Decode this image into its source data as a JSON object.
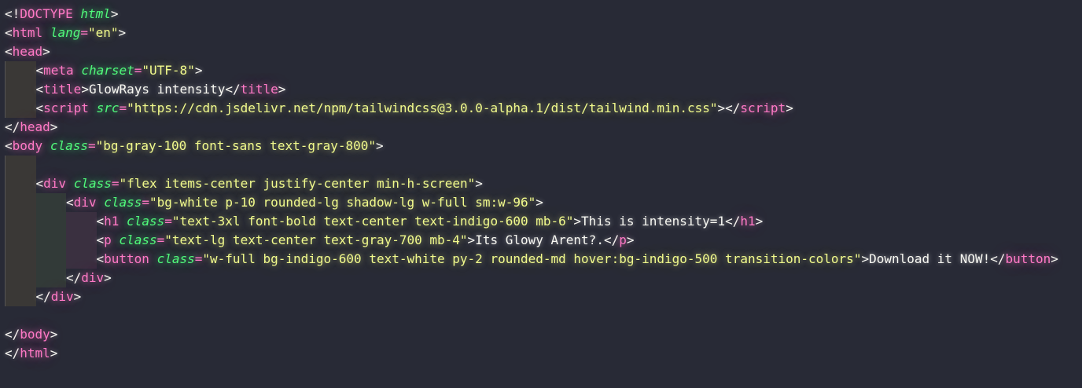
{
  "editor": {
    "colors": {
      "background": "#282a36",
      "tag": "#ff79c6",
      "attribute": "#50fa7b",
      "string": "#f1fa8c",
      "text": "#f8f8f2"
    },
    "lines": [
      {
        "indent": 0,
        "tokens": [
          [
            "p",
            "<!"
          ],
          [
            "t",
            "DOCTYPE"
          ],
          [
            "p",
            " "
          ],
          [
            "a",
            "html"
          ],
          [
            "p",
            ">"
          ]
        ]
      },
      {
        "indent": 0,
        "tokens": [
          [
            "p",
            "<"
          ],
          [
            "t",
            "html"
          ],
          [
            "p",
            " "
          ],
          [
            "a",
            "lang"
          ],
          [
            "t",
            "="
          ],
          [
            "s",
            "\"en\""
          ],
          [
            "p",
            ">"
          ]
        ]
      },
      {
        "indent": 0,
        "tokens": [
          [
            "p",
            "<"
          ],
          [
            "t",
            "head"
          ],
          [
            "p",
            ">"
          ]
        ]
      },
      {
        "indent": 1,
        "tokens": [
          [
            "p",
            "<"
          ],
          [
            "t",
            "meta"
          ],
          [
            "p",
            " "
          ],
          [
            "a",
            "charset"
          ],
          [
            "t",
            "="
          ],
          [
            "s",
            "\"UTF-8\""
          ],
          [
            "p",
            ">"
          ]
        ]
      },
      {
        "indent": 1,
        "tokens": [
          [
            "p",
            "<"
          ],
          [
            "t",
            "title"
          ],
          [
            "p",
            ">"
          ],
          [
            "x",
            "GlowRays intensity"
          ],
          [
            "p",
            "</"
          ],
          [
            "t",
            "title"
          ],
          [
            "p",
            ">"
          ]
        ]
      },
      {
        "indent": 1,
        "tokens": [
          [
            "p",
            "<"
          ],
          [
            "t",
            "script"
          ],
          [
            "p",
            " "
          ],
          [
            "a",
            "src"
          ],
          [
            "t",
            "="
          ],
          [
            "s",
            "\"https://cdn.jsdelivr.net/npm/tailwindcss@3.0.0-alpha.1/dist/tailwind.min.css\""
          ],
          [
            "p",
            "></"
          ],
          [
            "t",
            "script"
          ],
          [
            "p",
            ">"
          ]
        ]
      },
      {
        "indent": 0,
        "tokens": [
          [
            "p",
            "</"
          ],
          [
            "t",
            "head"
          ],
          [
            "p",
            ">"
          ]
        ]
      },
      {
        "indent": 0,
        "tokens": [
          [
            "p",
            "<"
          ],
          [
            "t",
            "body"
          ],
          [
            "p",
            " "
          ],
          [
            "a",
            "class"
          ],
          [
            "t",
            "="
          ],
          [
            "s",
            "\"bg-gray-100 font-sans text-gray-800\""
          ],
          [
            "p",
            ">"
          ]
        ]
      },
      {
        "indent": 0,
        "guides": 1,
        "tokens": []
      },
      {
        "indent": 1,
        "tokens": [
          [
            "p",
            "<"
          ],
          [
            "t",
            "div"
          ],
          [
            "p",
            " "
          ],
          [
            "a",
            "class"
          ],
          [
            "t",
            "="
          ],
          [
            "s",
            "\"flex items-center justify-center min-h-screen\""
          ],
          [
            "p",
            ">"
          ]
        ]
      },
      {
        "indent": 2,
        "tokens": [
          [
            "p",
            "<"
          ],
          [
            "t",
            "div"
          ],
          [
            "p",
            " "
          ],
          [
            "a",
            "class"
          ],
          [
            "t",
            "="
          ],
          [
            "s",
            "\"bg-white p-10 rounded-lg shadow-lg w-full sm:w-96\""
          ],
          [
            "p",
            ">"
          ]
        ]
      },
      {
        "indent": 3,
        "tokens": [
          [
            "p",
            "<"
          ],
          [
            "t",
            "h1"
          ],
          [
            "p",
            " "
          ],
          [
            "a",
            "class"
          ],
          [
            "t",
            "="
          ],
          [
            "s",
            "\"text-3xl font-bold text-center text-indigo-600 mb-6\""
          ],
          [
            "p",
            ">"
          ],
          [
            "x",
            "This is intensity=1"
          ],
          [
            "p",
            "</"
          ],
          [
            "t",
            "h1"
          ],
          [
            "p",
            ">"
          ]
        ]
      },
      {
        "indent": 3,
        "tokens": [
          [
            "p",
            "<"
          ],
          [
            "t",
            "p"
          ],
          [
            "p",
            " "
          ],
          [
            "a",
            "class"
          ],
          [
            "t",
            "="
          ],
          [
            "s",
            "\"text-lg text-center text-gray-700 mb-4\""
          ],
          [
            "p",
            ">"
          ],
          [
            "x",
            "Its Glowy Arent?."
          ],
          [
            "p",
            "</"
          ],
          [
            "t",
            "p"
          ],
          [
            "p",
            ">"
          ]
        ]
      },
      {
        "indent": 3,
        "tokens": [
          [
            "p",
            "<"
          ],
          [
            "t",
            "button"
          ],
          [
            "p",
            " "
          ],
          [
            "a",
            "class"
          ],
          [
            "t",
            "="
          ],
          [
            "s",
            "\"w-full bg-indigo-600 text-white py-2 rounded-md hover:bg-indigo-500 transition-colors\""
          ],
          [
            "p",
            ">"
          ],
          [
            "x",
            "Download it NOW!"
          ],
          [
            "p",
            "</"
          ],
          [
            "t",
            "button"
          ],
          [
            "p",
            ">"
          ]
        ]
      },
      {
        "indent": 2,
        "tokens": [
          [
            "p",
            "</"
          ],
          [
            "t",
            "div"
          ],
          [
            "p",
            ">"
          ]
        ]
      },
      {
        "indent": 1,
        "tokens": [
          [
            "p",
            "</"
          ],
          [
            "t",
            "div"
          ],
          [
            "p",
            ">"
          ]
        ]
      },
      {
        "indent": 0,
        "tokens": []
      },
      {
        "indent": 0,
        "tokens": [
          [
            "p",
            "</"
          ],
          [
            "t",
            "body"
          ],
          [
            "p",
            ">"
          ]
        ]
      },
      {
        "indent": 0,
        "tokens": [
          [
            "p",
            "</"
          ],
          [
            "t",
            "html"
          ],
          [
            "p",
            ">"
          ]
        ]
      }
    ]
  }
}
